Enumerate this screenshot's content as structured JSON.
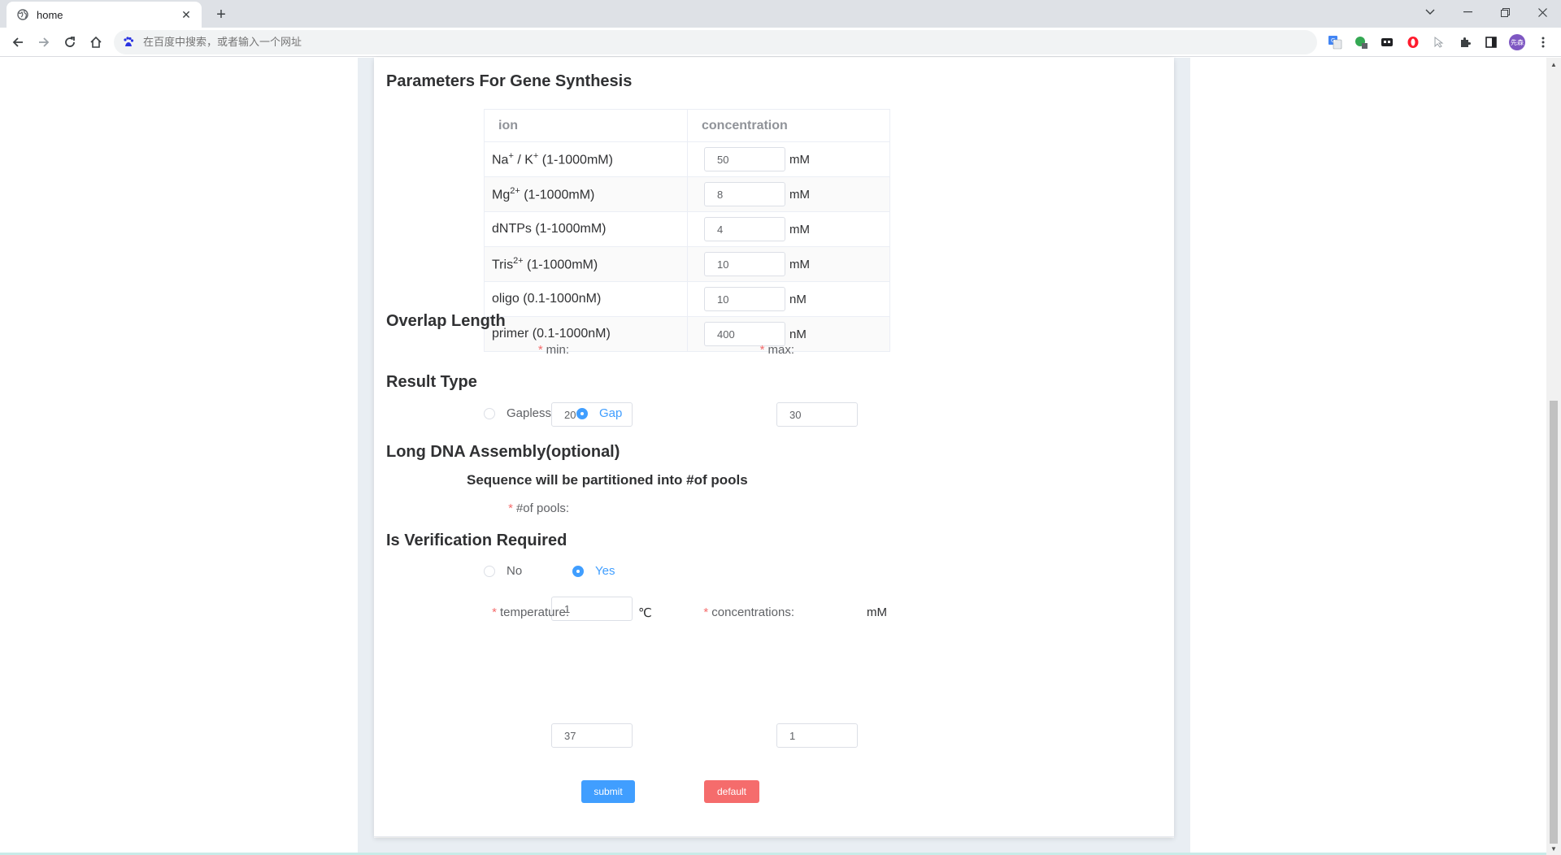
{
  "browser": {
    "tab_title": "home",
    "address_placeholder": "在百度中搜索，或者输入一个网址",
    "profile_initials": "先森"
  },
  "sections": {
    "gene_synthesis": "Parameters For Gene Synthesis",
    "overlap": "Overlap Length",
    "result_type": "Result Type",
    "long_dna": "Long DNA Assembly(optional)",
    "verification": "Is Verification Required"
  },
  "ion_table": {
    "headers": [
      "ion",
      "concentration"
    ],
    "rows": [
      {
        "name": "Na",
        "sup": "+",
        "mid": " / K",
        "sup2": "+",
        "range": " (1-1000mM)",
        "value": "50",
        "unit": "mM"
      },
      {
        "name": "Mg",
        "sup": "2+",
        "range": " (1-1000mM)",
        "value": "8",
        "unit": "mM"
      },
      {
        "name": "dNTPs",
        "range": " (1-1000mM)",
        "value": "4",
        "unit": "mM"
      },
      {
        "name": "Tris",
        "sup": "2+",
        "range": " (1-1000mM)",
        "value": "10",
        "unit": "mM"
      },
      {
        "name": "oligo",
        "range": " (0.1-1000nM)",
        "value": "10",
        "unit": "nM"
      },
      {
        "name": "primer",
        "range": " (0.1-1000nM)",
        "value": "400",
        "unit": "nM"
      }
    ]
  },
  "overlap": {
    "min_label": "min:",
    "min_value": "20",
    "max_label": "max:",
    "max_value": "30",
    "required_mark": "*"
  },
  "result_type": {
    "options": [
      "Gapless",
      "Gap"
    ],
    "selected": "Gap"
  },
  "long_dna": {
    "note": "Sequence will be partitioned into #of pools",
    "pools_label": "#of pools:",
    "pools_value": "1"
  },
  "verification": {
    "options": [
      "No",
      "Yes"
    ],
    "selected": "Yes",
    "temperature_label": "temperature:",
    "temperature_value": "37",
    "temperature_unit": "℃",
    "concentrations_label": "concentrations:",
    "concentrations_value": "1",
    "concentrations_unit": "mM"
  },
  "buttons": {
    "submit": "submit",
    "default": "default"
  },
  "colors": {
    "primary": "#409eff",
    "danger": "#f56c6c",
    "page_gray": "#e9eef3"
  }
}
